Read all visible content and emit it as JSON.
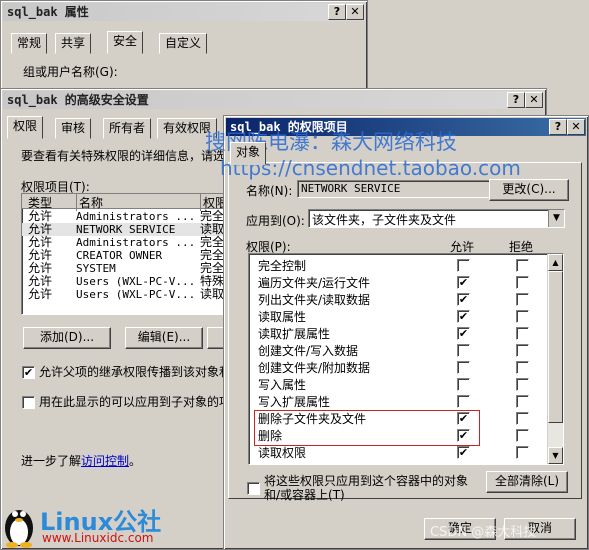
{
  "props_win": {
    "title": "sql_bak 属性",
    "tabs": [
      "常规",
      "共享",
      "安全",
      "自定义"
    ],
    "group_label": "组或用户名称(G):"
  },
  "adv_win": {
    "title": "sql_bak 的高级安全设置",
    "tabs": [
      "权限",
      "审核",
      "所有者",
      "有效权限"
    ],
    "desc": "要查看有关特殊权限的详细信息，请选",
    "entries_label": "权限项目(T):",
    "columns": [
      "类型",
      "名称",
      "权限"
    ],
    "rows": [
      {
        "type": "允许",
        "name": "Administrators ...",
        "perm": "完全"
      },
      {
        "type": "允许",
        "name": "NETWORK SERVICE",
        "perm": "读取"
      },
      {
        "type": "允许",
        "name": "Administrators ...",
        "perm": "完全"
      },
      {
        "type": "允许",
        "name": "CREATOR OWNER",
        "perm": "完全"
      },
      {
        "type": "允许",
        "name": "SYSTEM",
        "perm": "完全"
      },
      {
        "type": "允许",
        "name": "Users (WXL-PC-V...",
        "perm": "特殊"
      },
      {
        "type": "允许",
        "name": "Users (WXL-PC-V...",
        "perm": "读取"
      }
    ],
    "add_button": "添加(D)...",
    "edit_button": "编辑(E)...",
    "inherit_label": "允许父项的继承权限传播到该对象和",
    "replace_label": "用在此显示的可以应用到子对象的项",
    "more_prefix": "进一步了解",
    "more_link": "访问控制",
    "more_suffix": "。"
  },
  "perm_win": {
    "title": "sql_bak 的权限项目",
    "tab": "对象",
    "name_label": "名称(N):",
    "name_value": "NETWORK SERVICE",
    "change_button": "更改(C)...",
    "apply_label": "应用到(O):",
    "apply_value": "该文件夹，子文件夹及文件",
    "perm_label": "权限(P):",
    "allow_header": "允许",
    "deny_header": "拒绝",
    "permissions": [
      {
        "label": "完全控制",
        "allow": "",
        "deny": ""
      },
      {
        "label": "遍历文件夹/运行文件",
        "allow": "✔",
        "deny": ""
      },
      {
        "label": "列出文件夹/读取数据",
        "allow": "✔",
        "deny": ""
      },
      {
        "label": "读取属性",
        "allow": "✔",
        "deny": ""
      },
      {
        "label": "读取扩展属性",
        "allow": "✔",
        "deny": ""
      },
      {
        "label": "创建文件/写入数据",
        "allow": "",
        "deny": ""
      },
      {
        "label": "创建文件夹/附加数据",
        "allow": "",
        "deny": ""
      },
      {
        "label": "写入属性",
        "allow": "",
        "deny": ""
      },
      {
        "label": "写入扩展属性",
        "allow": "",
        "deny": ""
      },
      {
        "label": "删除子文件夹及文件",
        "allow": "✔",
        "deny": ""
      },
      {
        "label": "删除",
        "allow": "✔",
        "deny": ""
      },
      {
        "label": "读取权限",
        "allow": "✔",
        "deny": ""
      }
    ],
    "apply_only_line1": "将这些权限只应用到这个容器中的对象",
    "apply_only_line2": "和/或容器上(T)",
    "clear_all_button": "全部清除(L)",
    "ok_button": "确定",
    "cancel_button": "取消"
  },
  "watermarks": {
    "line1": "搜网陈电瀑：森大网络科技",
    "line2": "https://cnsendnet.taobao.com",
    "csdn": "CSDN @森大科技",
    "linux_logo": "Linux公社",
    "linux_url": "www.Linuxidc.com"
  },
  "colors": {
    "highlight_red": "#cc2222",
    "link_blue": "#0000cc",
    "watermark_blue": "#2a6bd3"
  }
}
